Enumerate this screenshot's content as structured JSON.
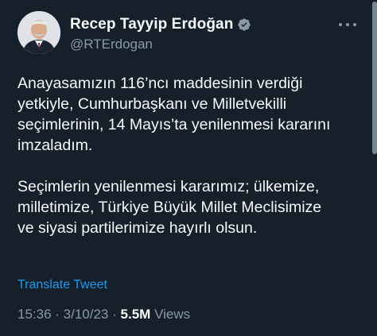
{
  "author": {
    "display_name": "Recep Tayyip Erdoğan",
    "handle": "@RTErdogan",
    "verified_badge_color": "#8b98a5",
    "avatar_icon": "profile-photo"
  },
  "tweet": {
    "paragraph1": [
      "Anayasamızın 116’ncı maddesinin verdiği",
      "yetkiyle, Cumhurbaşkanı ve Milletvekilli",
      "seçimlerinin, 14 Mayıs’ta yenilenmesi kararını",
      "imzaladım."
    ],
    "paragraph2": [
      "Seçimlerin yenilenmesi kararımız; ülkemize,",
      "milletimize, Türkiye Büyük Millet Meclisimize",
      "ve siyasi partilerimize hayırlı olsun."
    ],
    "translate_label": "Translate Tweet"
  },
  "meta": {
    "time": "15:36",
    "date": "3/10/23",
    "views_count": "5.5M",
    "views_label": "Views"
  },
  "colors": {
    "background": "#15202b",
    "text": "#f7f9f9",
    "secondary": "#8b98a5",
    "link": "#1d9bf0"
  }
}
